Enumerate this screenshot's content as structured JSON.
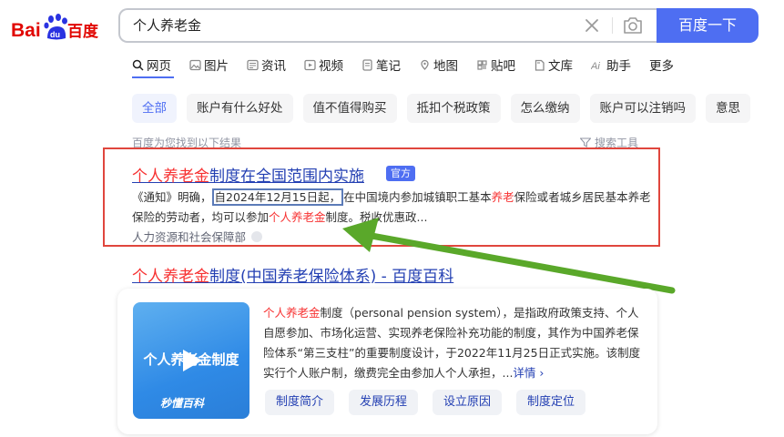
{
  "header": {
    "logo_text": "Bai du 百度",
    "search_value": "个人养老金",
    "search_button": "百度一下"
  },
  "tabs": [
    {
      "label": "网页",
      "icon": "search-icon",
      "active": true
    },
    {
      "label": "图片",
      "icon": "image-icon"
    },
    {
      "label": "资讯",
      "icon": "news-icon"
    },
    {
      "label": "视频",
      "icon": "video-icon"
    },
    {
      "label": "笔记",
      "icon": "note-icon"
    },
    {
      "label": "地图",
      "icon": "map-icon"
    },
    {
      "label": "贴吧",
      "icon": "tieba-icon"
    },
    {
      "label": "文库",
      "icon": "wenku-icon"
    },
    {
      "label": "助手",
      "icon": "ai-icon"
    },
    {
      "label": "更多"
    }
  ],
  "chips": [
    "全部",
    "账户有什么好处",
    "值不值得购买",
    "抵扣个税政策",
    "怎么缴纳",
    "账户可以注销吗",
    "意思"
  ],
  "results_meta": {
    "count_text": "百度为您找到以下结果",
    "tools_label": "搜索工具"
  },
  "result1": {
    "title_hl": "个人养老金",
    "title_rest": "制度在全国范围内实施",
    "badge": "官方",
    "snippet_1": "《通知》明确，",
    "snippet_date": "自2024年12月15日起，",
    "snippet_2": "在中国境内参加城镇职工基本",
    "snippet_hl1": "养老",
    "snippet_3": "保险或者城乡居民基本养老保险的劳动者，均可以参加",
    "snippet_hl2": "个人养老金",
    "snippet_4": "制度。税收优惠政...",
    "source": "人力资源和社会保障部"
  },
  "result2": {
    "title_hl": "个人养老金",
    "title_rest": "制度(中国养老保险体系) - 百度百科",
    "thumb_text": "个人养老金制度",
    "thumb_brand": "秒懂百科",
    "desc_hl": "个人养老金",
    "desc": "制度（personal pension system），是指政府政策支持、个人自愿参加、市场化运营、实现养老保险补充功能的制度，其作为中国养老保险体系“第三支柱”的重要制度设计，于2022年11月25日正式实施。该制度实行个人账户制，缴费完全由参加人个人承担，...",
    "more": "详情",
    "pills": [
      "制度简介",
      "发展历程",
      "设立原因",
      "制度定位"
    ]
  },
  "colors": {
    "brand_blue": "#4e6ef2",
    "link_blue": "#2440b3",
    "highlight_red": "#f73131",
    "annotation_red": "#e0463d",
    "annotation_green": "#5aa82a"
  }
}
